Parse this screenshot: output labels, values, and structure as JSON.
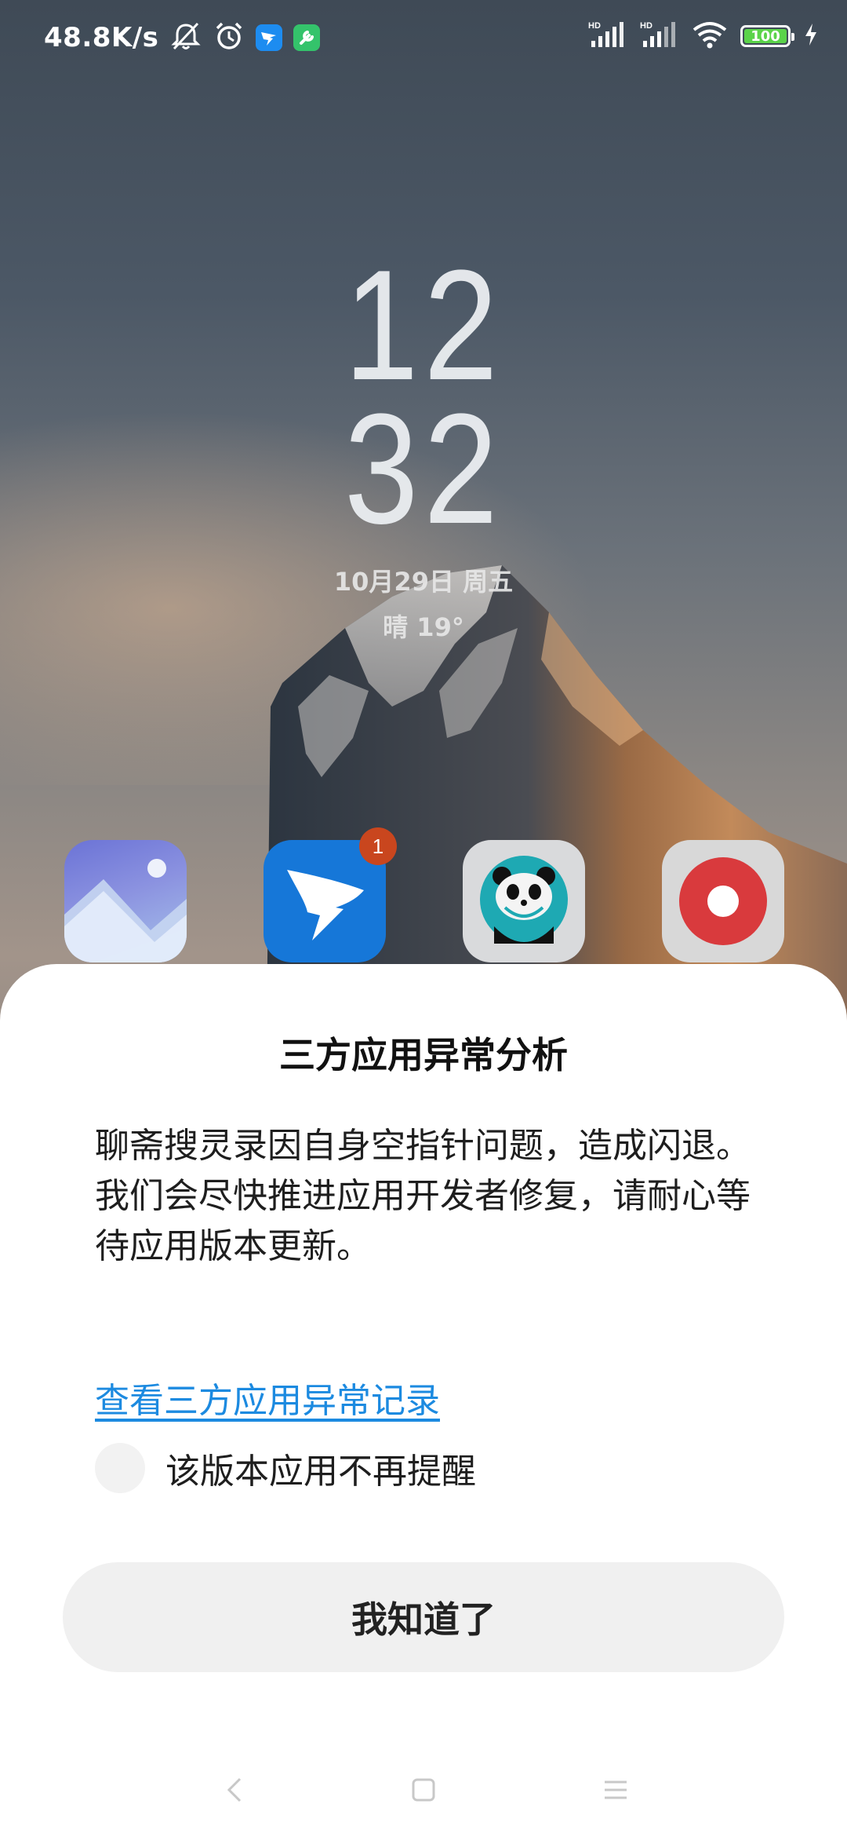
{
  "status_bar": {
    "net_speed": "48.8K/s",
    "signal_labels": [
      "HD",
      "HD"
    ],
    "battery_level": "100",
    "icons": [
      "mute-icon",
      "alarm-icon",
      "dingtalk-icon",
      "tool-app-icon",
      "signal-icon",
      "signal-icon",
      "wifi-icon",
      "battery-icon",
      "charging-icon"
    ],
    "battery_color": "#5bd34a"
  },
  "lockscreen": {
    "hour": "12",
    "minute": "32",
    "date": "10月29日 周五",
    "weather": "晴  19°"
  },
  "dock": {
    "icons": [
      {
        "name": "gallery-app-icon"
      },
      {
        "name": "dingtalk-app-icon",
        "badge": "1"
      },
      {
        "name": "panda-app-icon"
      },
      {
        "name": "recorder-app-icon"
      }
    ]
  },
  "dialog": {
    "title": "三方应用异常分析",
    "message_line1": "聊斋搜灵录因自身空指针问题，造成闪退。",
    "message_line2": "我们会尽快推进应用开发者修复，请耐心等待应用版本更新。",
    "link_text": "查看三方应用异常记录",
    "link_color": "#1c8ae0",
    "checkbox_label": "该版本应用不再提醒",
    "checkbox_checked": false,
    "button_label": "我知道了"
  },
  "nav_bar": {
    "icons": [
      "back-icon",
      "home-icon",
      "menu-icon"
    ]
  }
}
